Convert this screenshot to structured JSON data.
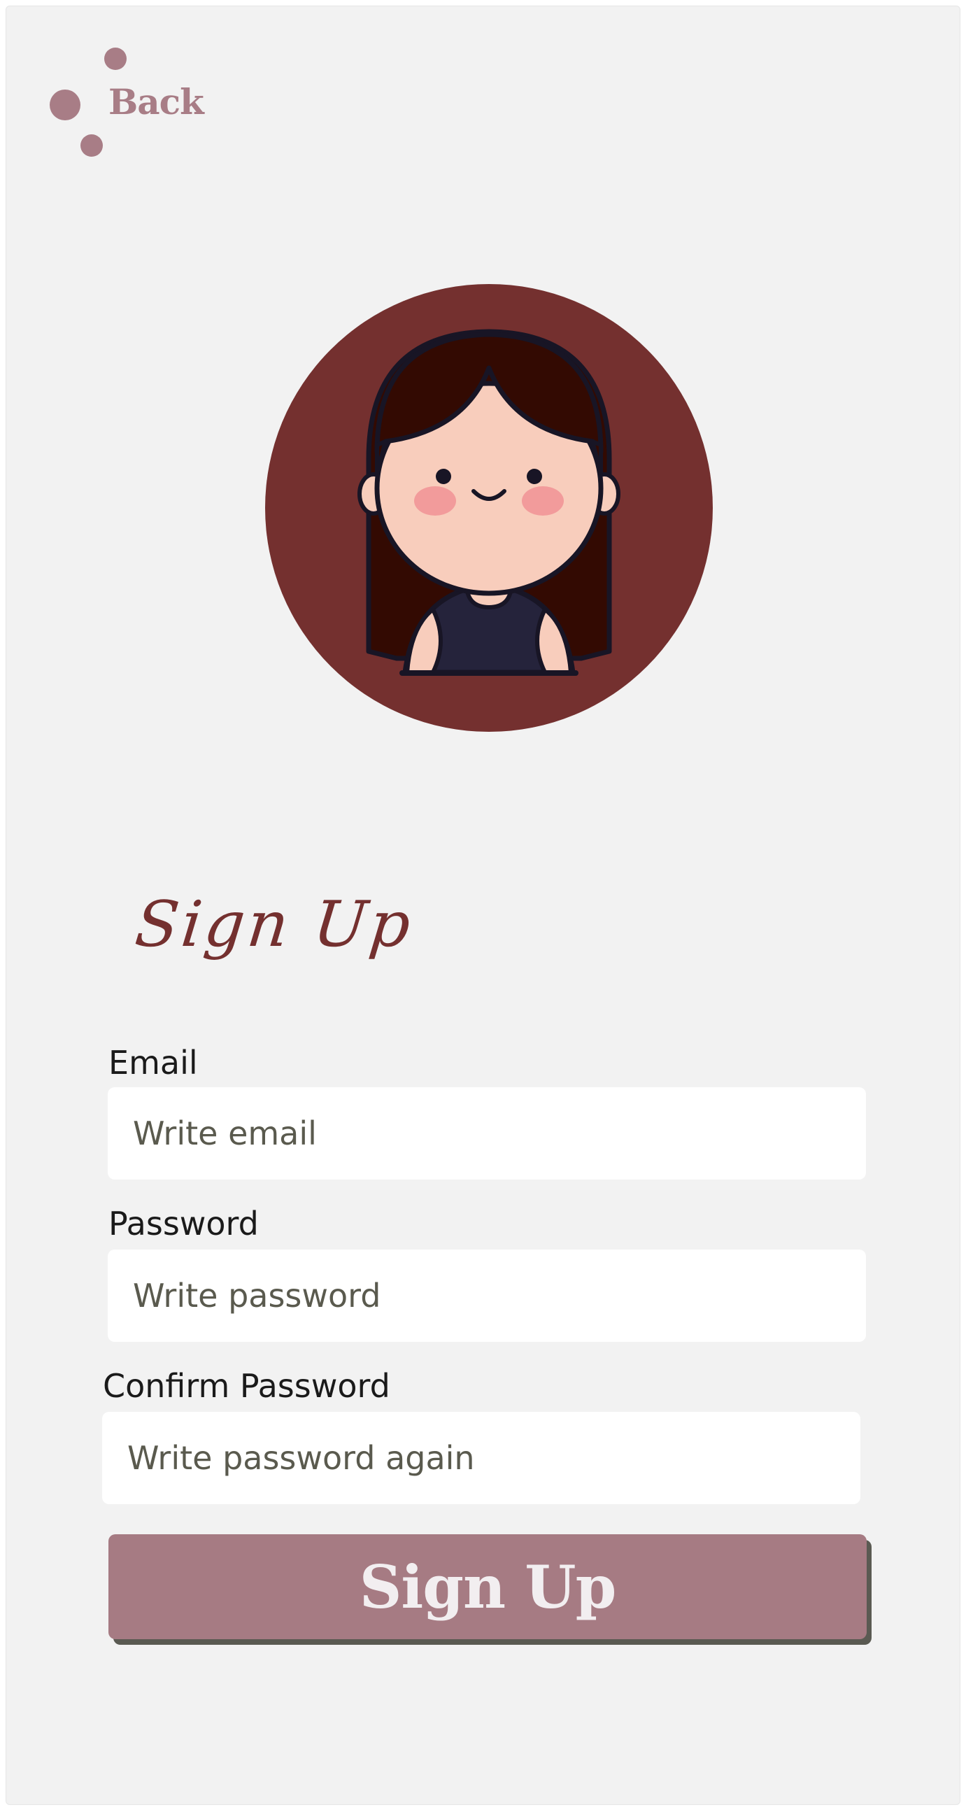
{
  "nav": {
    "back_label": "Back"
  },
  "avatar": {
    "icon": "girl-avatar-icon",
    "background_color": "#74302f"
  },
  "form": {
    "title": "Sign Up",
    "email": {
      "label": "Email",
      "placeholder": "Write email",
      "value": ""
    },
    "password": {
      "label": "Password",
      "placeholder": "Write password",
      "value": ""
    },
    "confirm_password": {
      "label": "Confirm Password",
      "placeholder": "Write password again",
      "value": ""
    },
    "submit_label": "Sign Up"
  },
  "colors": {
    "accent": "#a67b83",
    "title": "#74302f",
    "background": "#f2f2f2"
  }
}
